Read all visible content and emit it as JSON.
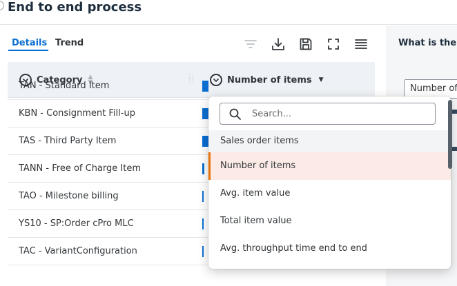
{
  "header": {
    "title": "End to end process"
  },
  "tabs": [
    {
      "label": "Details"
    },
    {
      "label": "Trend"
    }
  ],
  "toolbar": {
    "icons": [
      "filter-icon",
      "download-icon",
      "save-icon",
      "fullscreen-icon",
      "menu-icon"
    ]
  },
  "table": {
    "columns": [
      "Category",
      "Number of items"
    ],
    "rows": [
      {
        "category": "TAN - Standard Item",
        "value": ""
      },
      {
        "category": "KBN - Consignment Fill-up",
        "value": ""
      },
      {
        "category": "TAS - Third Party Item",
        "value": ""
      },
      {
        "category": "TANN - Free of Charge Item",
        "value": ""
      },
      {
        "category": "TAO - Milestone billing",
        "value": ""
      },
      {
        "category": "YS10 - SP:Order cPro MLC",
        "value": ""
      },
      {
        "category": "TAC - VariantConfiguration",
        "value": "3"
      }
    ]
  },
  "right_panel": {
    "title": "What is the e",
    "select_value": "Number of"
  },
  "dropdown": {
    "search_placeholder": "Search...",
    "group_label": "Sales order items",
    "options": [
      "Number of items",
      "Avg. item value",
      "Total item value",
      "Avg. throughput time end to end"
    ],
    "selected_index": 0
  },
  "colors": {
    "accent": "#0a6ed1",
    "selected_marker": "#e9730c",
    "selected_bg": "#fbeae5"
  }
}
